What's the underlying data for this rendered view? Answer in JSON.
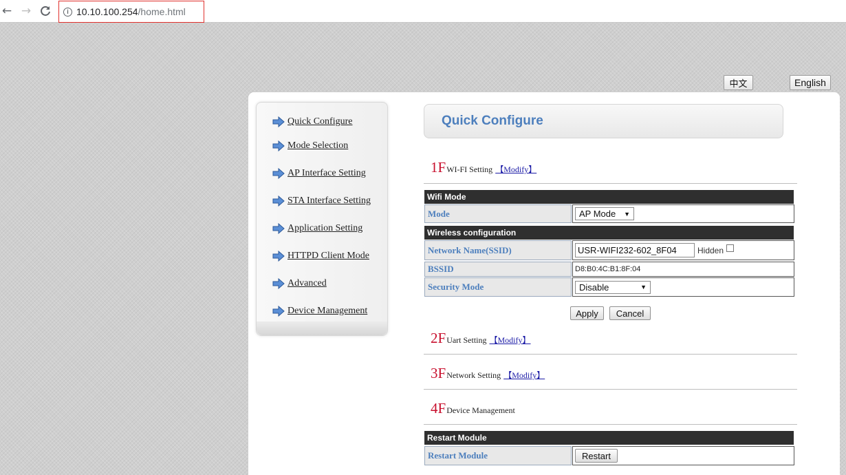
{
  "browser": {
    "url_host": "10.10.100.254",
    "url_path": "/home.html"
  },
  "language": {
    "chinese": "中文",
    "english": "English"
  },
  "sidebar": {
    "items": [
      {
        "label": "Quick Configure"
      },
      {
        "label": "Mode Selection"
      },
      {
        "label": "AP Interface Setting"
      },
      {
        "label": "STA Interface Setting"
      },
      {
        "label": "Application Setting"
      },
      {
        "label": "HTTPD Client Mode"
      },
      {
        "label": "Advanced"
      },
      {
        "label": "Device Management"
      }
    ]
  },
  "main": {
    "title": "Quick Configure",
    "sections": [
      {
        "floor": "1F",
        "label": "WI-FI Setting",
        "modify": "【Modify】"
      },
      {
        "floor": "2F",
        "label": "Uart Setting",
        "modify": "【Modify】"
      },
      {
        "floor": "3F",
        "label": "Network Setting",
        "modify": "【Modify】"
      },
      {
        "floor": "4F",
        "label": "Device Management"
      }
    ],
    "wifi": {
      "mode_header": "Wifi Mode",
      "mode_label": "Mode",
      "mode_value": "AP Mode",
      "wireless_header": "Wireless configuration",
      "ssid_label": "Network Name(SSID)",
      "ssid_value": "USR-WIFI232-602_8F04",
      "hidden_label": "Hidden",
      "hidden_checked": false,
      "bssid_label": "BSSID",
      "bssid_value": "D8:B0:4C:B1:8F:04",
      "security_label": "Security Mode",
      "security_value": "Disable",
      "apply": "Apply",
      "cancel": "Cancel"
    },
    "restart": {
      "header": "Restart Module",
      "label": "Restart Module",
      "button": "Restart"
    }
  },
  "colors": {
    "accent": "#4d7fbd",
    "floor_red": "#c8102e",
    "header_dark": "#2f2f2f",
    "link_blue": "#1a1aa6"
  }
}
